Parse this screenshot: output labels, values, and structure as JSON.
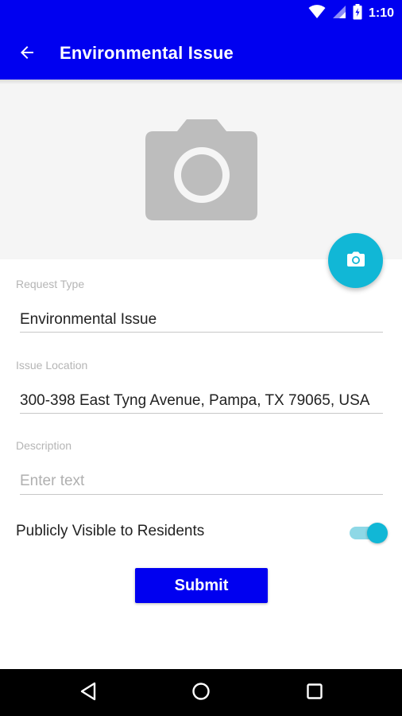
{
  "status_bar": {
    "time": "1:10",
    "icons": [
      "wifi-icon",
      "signal-icon",
      "battery-icon"
    ]
  },
  "app_bar": {
    "title": "Environmental Issue",
    "back_icon": "arrow-left-icon"
  },
  "photo": {
    "placeholder_icon": "camera-icon",
    "fab_icon": "camera-icon"
  },
  "form": {
    "request_type": {
      "label": "Request Type",
      "value": "Environmental Issue"
    },
    "issue_location": {
      "label": "Issue Location",
      "value": "300-398 East Tyng Avenue, Pampa, TX 79065, USA"
    },
    "description": {
      "label": "Description",
      "placeholder": "Enter text",
      "value": ""
    },
    "public_toggle": {
      "label": "Publicly Visible to Residents",
      "checked": true
    },
    "submit_label": "Submit"
  },
  "nav_bar": {
    "icons": [
      "back-triangle-icon",
      "home-circle-icon",
      "recents-square-icon"
    ]
  },
  "colors": {
    "primary": "#0000f0",
    "accent": "#11b7d6",
    "photo_background": "#f5f5f5"
  }
}
